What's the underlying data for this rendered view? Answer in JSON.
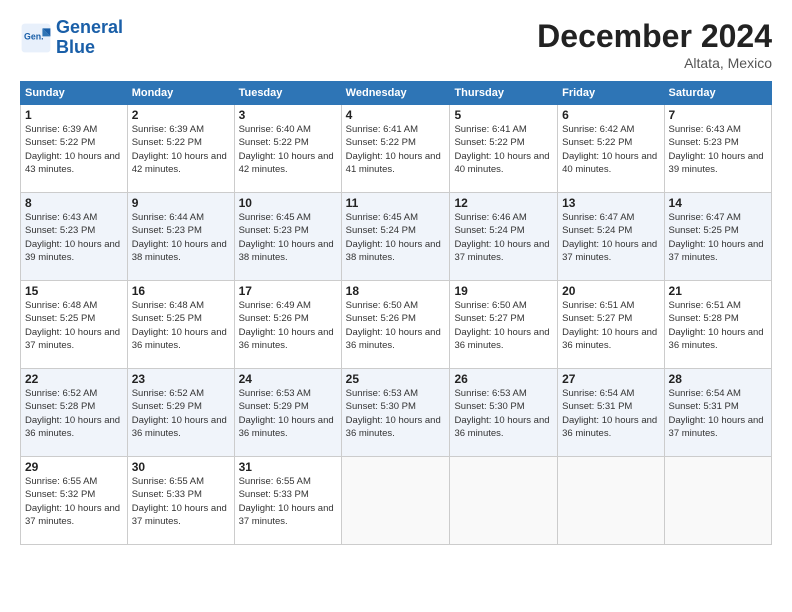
{
  "logo": {
    "line1": "General",
    "line2": "Blue"
  },
  "title": "December 2024",
  "location": "Altata, Mexico",
  "days_of_week": [
    "Sunday",
    "Monday",
    "Tuesday",
    "Wednesday",
    "Thursday",
    "Friday",
    "Saturday"
  ],
  "weeks": [
    [
      {
        "day": "1",
        "sunrise": "6:39 AM",
        "sunset": "5:22 PM",
        "daylight": "10 hours and 43 minutes."
      },
      {
        "day": "2",
        "sunrise": "6:39 AM",
        "sunset": "5:22 PM",
        "daylight": "10 hours and 42 minutes."
      },
      {
        "day": "3",
        "sunrise": "6:40 AM",
        "sunset": "5:22 PM",
        "daylight": "10 hours and 42 minutes."
      },
      {
        "day": "4",
        "sunrise": "6:41 AM",
        "sunset": "5:22 PM",
        "daylight": "10 hours and 41 minutes."
      },
      {
        "day": "5",
        "sunrise": "6:41 AM",
        "sunset": "5:22 PM",
        "daylight": "10 hours and 40 minutes."
      },
      {
        "day": "6",
        "sunrise": "6:42 AM",
        "sunset": "5:22 PM",
        "daylight": "10 hours and 40 minutes."
      },
      {
        "day": "7",
        "sunrise": "6:43 AM",
        "sunset": "5:23 PM",
        "daylight": "10 hours and 39 minutes."
      }
    ],
    [
      {
        "day": "8",
        "sunrise": "6:43 AM",
        "sunset": "5:23 PM",
        "daylight": "10 hours and 39 minutes."
      },
      {
        "day": "9",
        "sunrise": "6:44 AM",
        "sunset": "5:23 PM",
        "daylight": "10 hours and 38 minutes."
      },
      {
        "day": "10",
        "sunrise": "6:45 AM",
        "sunset": "5:23 PM",
        "daylight": "10 hours and 38 minutes."
      },
      {
        "day": "11",
        "sunrise": "6:45 AM",
        "sunset": "5:24 PM",
        "daylight": "10 hours and 38 minutes."
      },
      {
        "day": "12",
        "sunrise": "6:46 AM",
        "sunset": "5:24 PM",
        "daylight": "10 hours and 37 minutes."
      },
      {
        "day": "13",
        "sunrise": "6:47 AM",
        "sunset": "5:24 PM",
        "daylight": "10 hours and 37 minutes."
      },
      {
        "day": "14",
        "sunrise": "6:47 AM",
        "sunset": "5:25 PM",
        "daylight": "10 hours and 37 minutes."
      }
    ],
    [
      {
        "day": "15",
        "sunrise": "6:48 AM",
        "sunset": "5:25 PM",
        "daylight": "10 hours and 37 minutes."
      },
      {
        "day": "16",
        "sunrise": "6:48 AM",
        "sunset": "5:25 PM",
        "daylight": "10 hours and 36 minutes."
      },
      {
        "day": "17",
        "sunrise": "6:49 AM",
        "sunset": "5:26 PM",
        "daylight": "10 hours and 36 minutes."
      },
      {
        "day": "18",
        "sunrise": "6:50 AM",
        "sunset": "5:26 PM",
        "daylight": "10 hours and 36 minutes."
      },
      {
        "day": "19",
        "sunrise": "6:50 AM",
        "sunset": "5:27 PM",
        "daylight": "10 hours and 36 minutes."
      },
      {
        "day": "20",
        "sunrise": "6:51 AM",
        "sunset": "5:27 PM",
        "daylight": "10 hours and 36 minutes."
      },
      {
        "day": "21",
        "sunrise": "6:51 AM",
        "sunset": "5:28 PM",
        "daylight": "10 hours and 36 minutes."
      }
    ],
    [
      {
        "day": "22",
        "sunrise": "6:52 AM",
        "sunset": "5:28 PM",
        "daylight": "10 hours and 36 minutes."
      },
      {
        "day": "23",
        "sunrise": "6:52 AM",
        "sunset": "5:29 PM",
        "daylight": "10 hours and 36 minutes."
      },
      {
        "day": "24",
        "sunrise": "6:53 AM",
        "sunset": "5:29 PM",
        "daylight": "10 hours and 36 minutes."
      },
      {
        "day": "25",
        "sunrise": "6:53 AM",
        "sunset": "5:30 PM",
        "daylight": "10 hours and 36 minutes."
      },
      {
        "day": "26",
        "sunrise": "6:53 AM",
        "sunset": "5:30 PM",
        "daylight": "10 hours and 36 minutes."
      },
      {
        "day": "27",
        "sunrise": "6:54 AM",
        "sunset": "5:31 PM",
        "daylight": "10 hours and 36 minutes."
      },
      {
        "day": "28",
        "sunrise": "6:54 AM",
        "sunset": "5:31 PM",
        "daylight": "10 hours and 37 minutes."
      }
    ],
    [
      {
        "day": "29",
        "sunrise": "6:55 AM",
        "sunset": "5:32 PM",
        "daylight": "10 hours and 37 minutes."
      },
      {
        "day": "30",
        "sunrise": "6:55 AM",
        "sunset": "5:33 PM",
        "daylight": "10 hours and 37 minutes."
      },
      {
        "day": "31",
        "sunrise": "6:55 AM",
        "sunset": "5:33 PM",
        "daylight": "10 hours and 37 minutes."
      },
      null,
      null,
      null,
      null
    ]
  ]
}
